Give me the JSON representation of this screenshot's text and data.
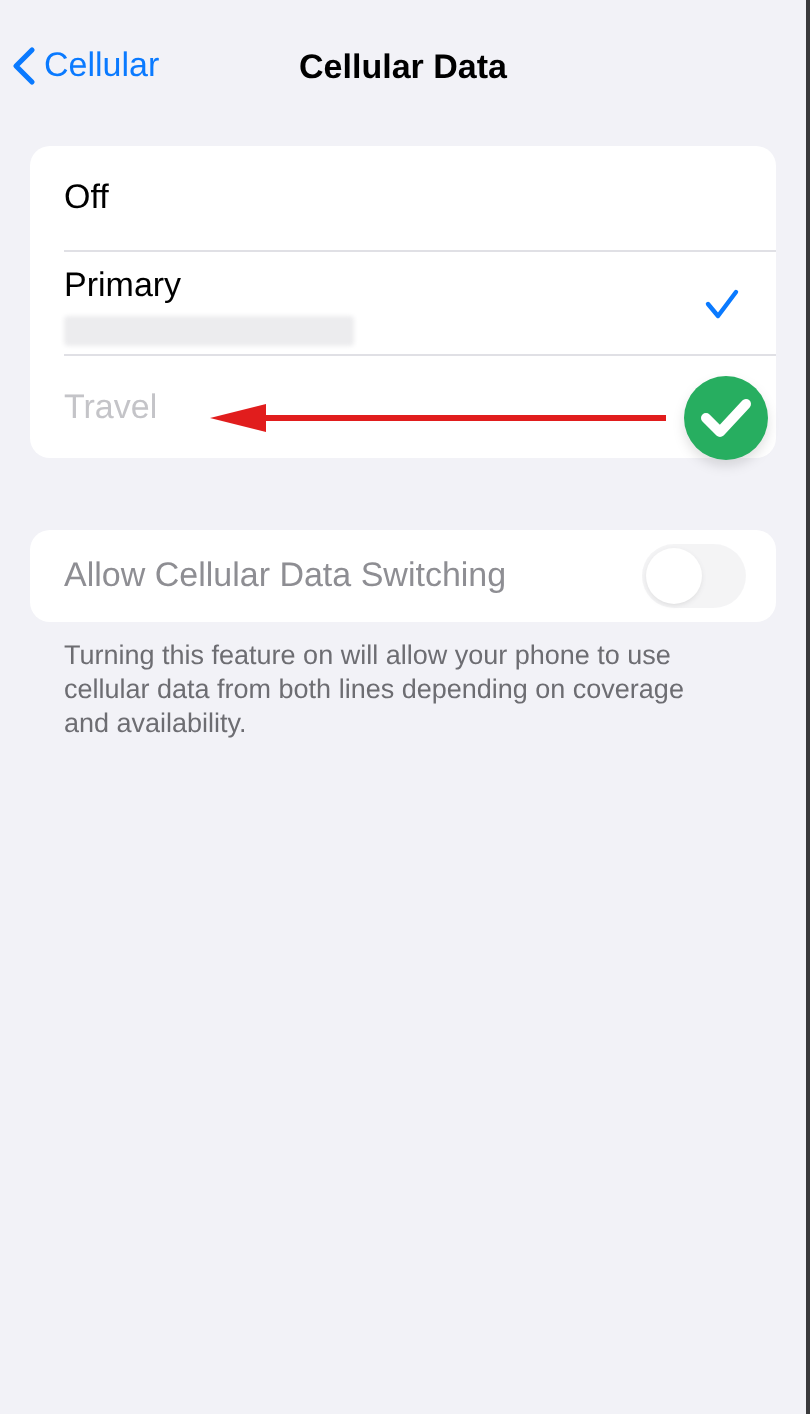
{
  "nav": {
    "back_label": "Cellular",
    "title": "Cellular Data"
  },
  "options": [
    {
      "label": "Off",
      "selected": false,
      "disabled": false,
      "redacted_detail": false,
      "annotated": false
    },
    {
      "label": "Primary",
      "selected": true,
      "disabled": false,
      "redacted_detail": true,
      "annotated": false
    },
    {
      "label": "Travel",
      "selected": false,
      "disabled": true,
      "redacted_detail": false,
      "annotated": true
    }
  ],
  "switching": {
    "label": "Allow Cellular Data Switching",
    "on": false,
    "disabled": true
  },
  "footer": "Turning this feature on will allow your phone to use cellular data from both lines depending on coverage and availability."
}
